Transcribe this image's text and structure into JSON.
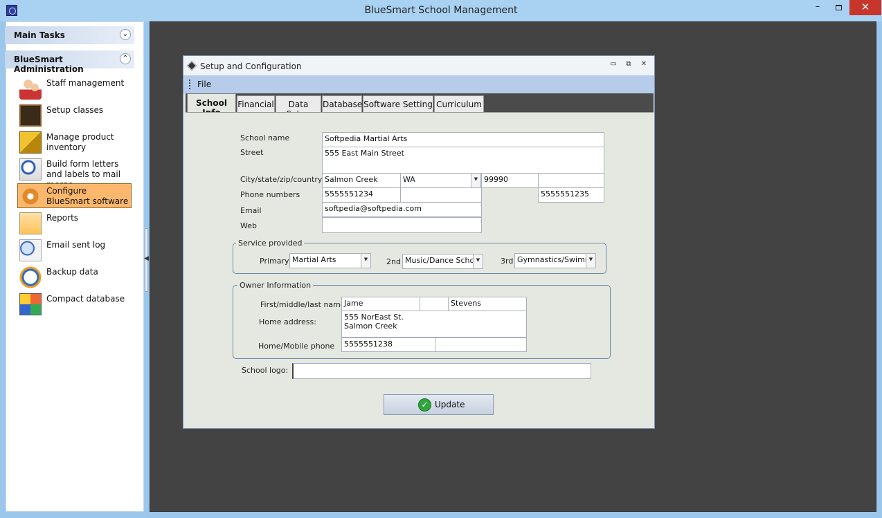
{
  "app": {
    "title": "BlueSmart School Management",
    "window_controls": {
      "minimize": "–",
      "close": "✕"
    }
  },
  "sidebar": {
    "groups": [
      {
        "label": "Main Tasks",
        "chevron": "⌄⌄"
      },
      {
        "label": "BlueSmart Administration",
        "chevron": "⌃⌃"
      }
    ],
    "items": [
      {
        "label": "Staff management",
        "icon": "staff-icon"
      },
      {
        "label": "Setup classes",
        "icon": "classroom-icon"
      },
      {
        "label": "Manage product inventory",
        "icon": "box-icon"
      },
      {
        "label": "Build form letters and labels to mail merge",
        "icon": "letter-icon"
      },
      {
        "label": "Configure BlueSmart software",
        "icon": "gear-icon",
        "selected": true
      },
      {
        "label": "Reports",
        "icon": "chart-icon"
      },
      {
        "label": "Email sent log",
        "icon": "magnifier-icon"
      },
      {
        "label": "Backup data",
        "icon": "clock-icon"
      },
      {
        "label": "Compact database",
        "icon": "cube-icon"
      }
    ]
  },
  "dialog": {
    "title": "Setup and Configuration",
    "controls": {
      "minimize": "▭",
      "maximize": "⧉",
      "close": "✕"
    },
    "menu": {
      "file": "File"
    },
    "tabs": [
      {
        "label": "School Info",
        "active": true
      },
      {
        "label": "Financial"
      },
      {
        "label": "Data Setup"
      },
      {
        "label": "Database"
      },
      {
        "label": "Software Setting"
      },
      {
        "label": "Curriculum"
      }
    ],
    "school_info": {
      "labels": {
        "school_name": "School name",
        "street": "Street",
        "city_state_zip": "City/state/zip/country",
        "phone": "Phone numbers",
        "email": "Email",
        "web": "Web"
      },
      "values": {
        "school_name": "Softpedia Martial Arts",
        "street": "555 East Main Street",
        "city": "Salmon Creek",
        "state": "WA",
        "zip": "99990",
        "country": "",
        "phone1": "5555551234",
        "phone2": "",
        "phone3": "5555551235",
        "email": "softpedia@softpedia.com",
        "web": ""
      }
    },
    "service": {
      "title": "Service provided",
      "primary_label": "Primary",
      "primary": "Martial Arts",
      "second_label": "2nd",
      "second": "Music/Dance School",
      "third_label": "3rd",
      "third": "Gymnastics/Swimmir"
    },
    "owner": {
      "title": "Owner Information",
      "name_label": "First/middle/last name",
      "first": "Jame",
      "middle": "",
      "last": "Stevens",
      "address_label": "Home address:",
      "address_line1": "555 NorEast St.",
      "address_line2": "Salmon Creek",
      "phone_label": "Home/Mobile phone",
      "home_phone": "5555551238",
      "mobile_phone": ""
    },
    "logo": {
      "label": "School logo:",
      "value": ""
    },
    "update_button": "Update"
  }
}
